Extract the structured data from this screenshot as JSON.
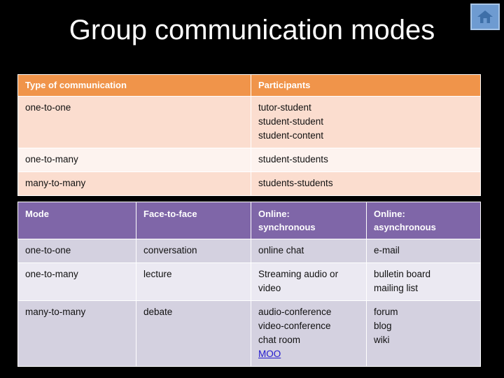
{
  "slide": {
    "title": "Group communication modes",
    "background_color": "#000000",
    "title_color": "#FFFFFF"
  },
  "home_icon": {
    "name": "home-icon",
    "tile_color": "#6E9BD1",
    "border_color": "#A8C6E8",
    "glyph_color": "#3E6FA8"
  },
  "table_communication": {
    "header_bg": "#F0944A",
    "row_bg_odd": "#FBDDCF",
    "row_bg_even": "#FDF3EF",
    "headers": [
      "Type of communication",
      "Participants"
    ],
    "rows": [
      {
        "type": "one-to-one",
        "participants": [
          "tutor-student",
          "student-student",
          "student-content"
        ]
      },
      {
        "type": "one-to-many",
        "participants": [
          "student-students"
        ]
      },
      {
        "type": "many-to-many",
        "participants": [
          "students-students"
        ]
      }
    ]
  },
  "table_modes": {
    "header_bg": "#7F66A8",
    "row_bg_odd": "#D4D1E0",
    "row_bg_even": "#EBE9F2",
    "link_color": "#2118CF",
    "headers": [
      "Mode",
      "Face-to-face",
      "Online: synchronous",
      "Online: asynchronous"
    ],
    "header_lines": [
      [
        "Mode"
      ],
      [
        "Face-to-face"
      ],
      [
        "Online:",
        "synchronous"
      ],
      [
        "Online:",
        "asynchronous"
      ]
    ],
    "rows": [
      {
        "mode": "one-to-one",
        "face_to_face": [
          "conversation"
        ],
        "online_sync": [
          "online chat"
        ],
        "online_async": [
          "e-mail"
        ]
      },
      {
        "mode": "one-to-many",
        "face_to_face": [
          "lecture"
        ],
        "online_sync": [
          "Streaming audio or video"
        ],
        "online_async": [
          "bulletin board",
          "mailing list"
        ]
      },
      {
        "mode": "many-to-many",
        "face_to_face": [
          "debate"
        ],
        "online_sync": [
          "audio-conference",
          "video-conference",
          "chat room"
        ],
        "online_sync_link": "MOO",
        "online_async": [
          "forum",
          "blog",
          "wiki"
        ]
      }
    ]
  }
}
